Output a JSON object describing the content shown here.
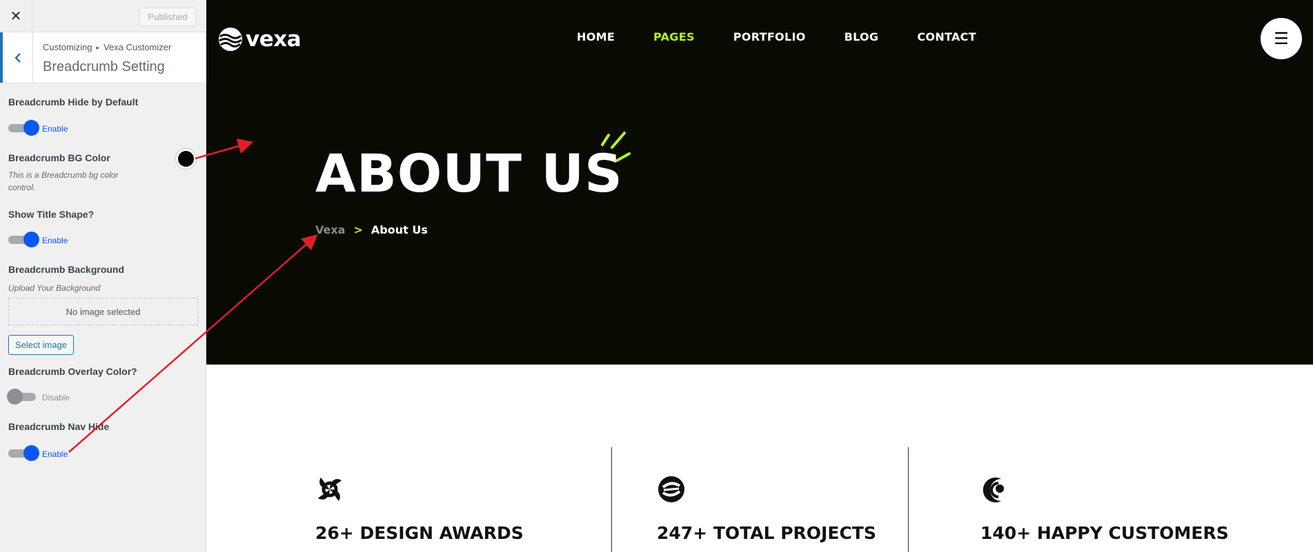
{
  "customizer": {
    "close_label": "✕",
    "publish_label": "Published",
    "breadcrumb": [
      "Customizing",
      "Vexa Customizer"
    ],
    "breadcrumb_sep": "▸",
    "section_title": "Breadcrumb Setting",
    "controls": {
      "hide_default": {
        "label": "Breadcrumb Hide by Default",
        "state": "Enable"
      },
      "bg_color": {
        "label": "Breadcrumb BG Color",
        "description": "This is a Breadcrumb bg color control.",
        "value": "#000000"
      },
      "title_shape": {
        "label": "Show Title Shape?",
        "state": "Enable"
      },
      "background": {
        "label": "Breadcrumb Background",
        "description": "Upload Your Background",
        "empty_text": "No image selected",
        "button_label": "Select image"
      },
      "overlay": {
        "label": "Breadcrumb Overlay Color?",
        "state": "Disable"
      },
      "nav_hide": {
        "label": "Breadcrumb Nav Hide",
        "state": "Enable"
      }
    }
  },
  "site": {
    "logo_text": "vexa",
    "nav": [
      "HOME",
      "PAGES",
      "PORTFOLIO",
      "BLOG",
      "CONTACT"
    ],
    "active_nav": "PAGES",
    "menu_icon": "☰",
    "hero_title": "ABOUT US",
    "breadcrumb": {
      "home": "Vexa",
      "sep": ">",
      "current": "About Us"
    },
    "stats": [
      {
        "title": "26+ DESIGN AWARDS"
      },
      {
        "title": "247+ TOTAL PROJECTS"
      },
      {
        "title": "140+ HAPPY CUSTOMERS"
      }
    ]
  },
  "colors": {
    "accent": "#b4f51d",
    "hero_bg": "#090a01",
    "toggle_on": "#0a57f5",
    "annotation_arrow": "#e31e24"
  }
}
